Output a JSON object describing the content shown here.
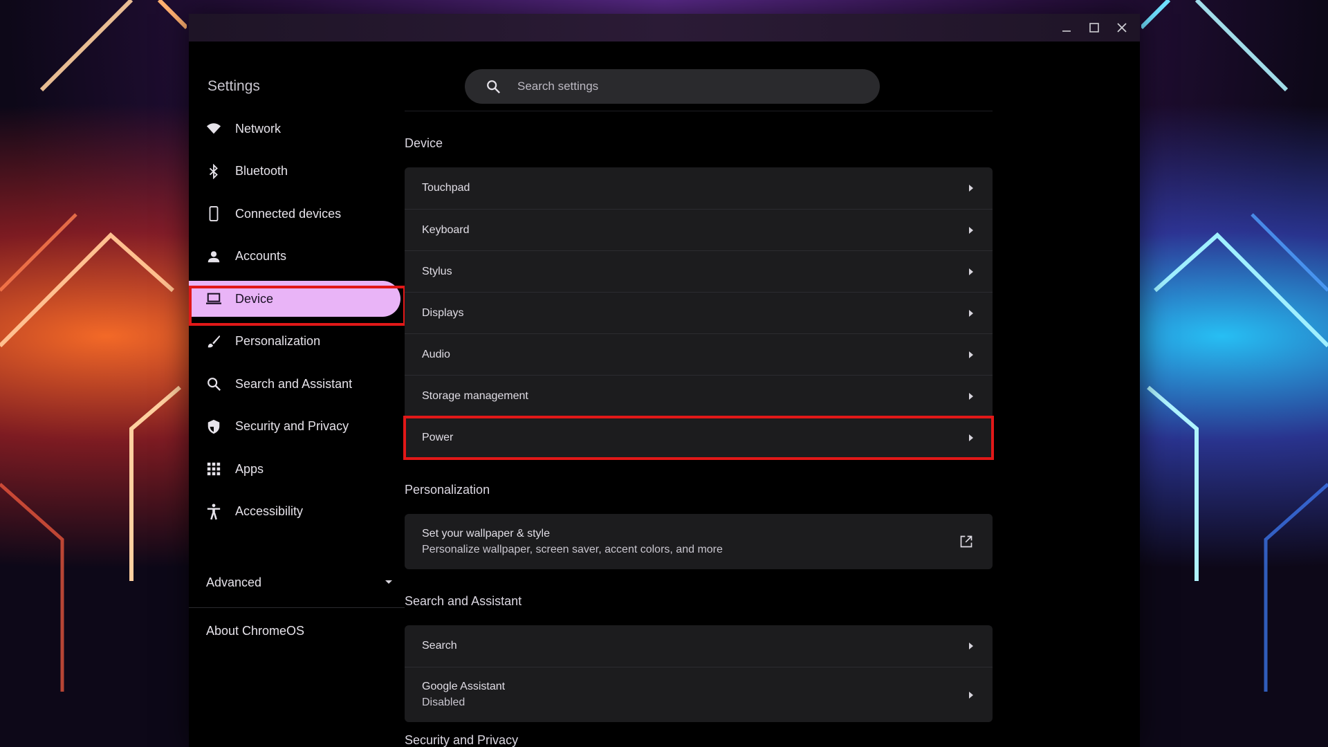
{
  "window": {
    "controls": [
      "minimize",
      "maximize",
      "close"
    ]
  },
  "sidebar": {
    "title": "Settings",
    "items": [
      {
        "label": "Network",
        "icon": "wifi-icon"
      },
      {
        "label": "Bluetooth",
        "icon": "bluetooth-icon"
      },
      {
        "label": "Connected devices",
        "icon": "phone-icon"
      },
      {
        "label": "Accounts",
        "icon": "person-icon"
      },
      {
        "label": "Device",
        "icon": "laptop-icon",
        "active": true
      },
      {
        "label": "Personalization",
        "icon": "brush-icon"
      },
      {
        "label": "Search and Assistant",
        "icon": "search-icon"
      },
      {
        "label": "Security and Privacy",
        "icon": "shield-icon"
      },
      {
        "label": "Apps",
        "icon": "apps-grid-icon"
      },
      {
        "label": "Accessibility",
        "icon": "accessibility-icon"
      }
    ],
    "advanced": "Advanced",
    "about": "About ChromeOS"
  },
  "search": {
    "placeholder": "Search settings"
  },
  "sections": {
    "device": {
      "title": "Device",
      "rows": [
        "Touchpad",
        "Keyboard",
        "Stylus",
        "Displays",
        "Audio",
        "Storage management",
        "Power"
      ]
    },
    "personalization": {
      "title": "Personalization",
      "row_title": "Set your wallpaper & style",
      "row_sub": "Personalize wallpaper, screen saver, accent colors, and more"
    },
    "search_assistant": {
      "title": "Search and Assistant",
      "search": "Search",
      "assistant": "Google Assistant",
      "assistant_status": "Disabled"
    },
    "security": {
      "title": "Security and Privacy"
    }
  },
  "colors": {
    "active_nav": "#e9b4f7",
    "highlight": "#e11818",
    "card": "#1c1c1e",
    "window_bg": "#000000"
  }
}
